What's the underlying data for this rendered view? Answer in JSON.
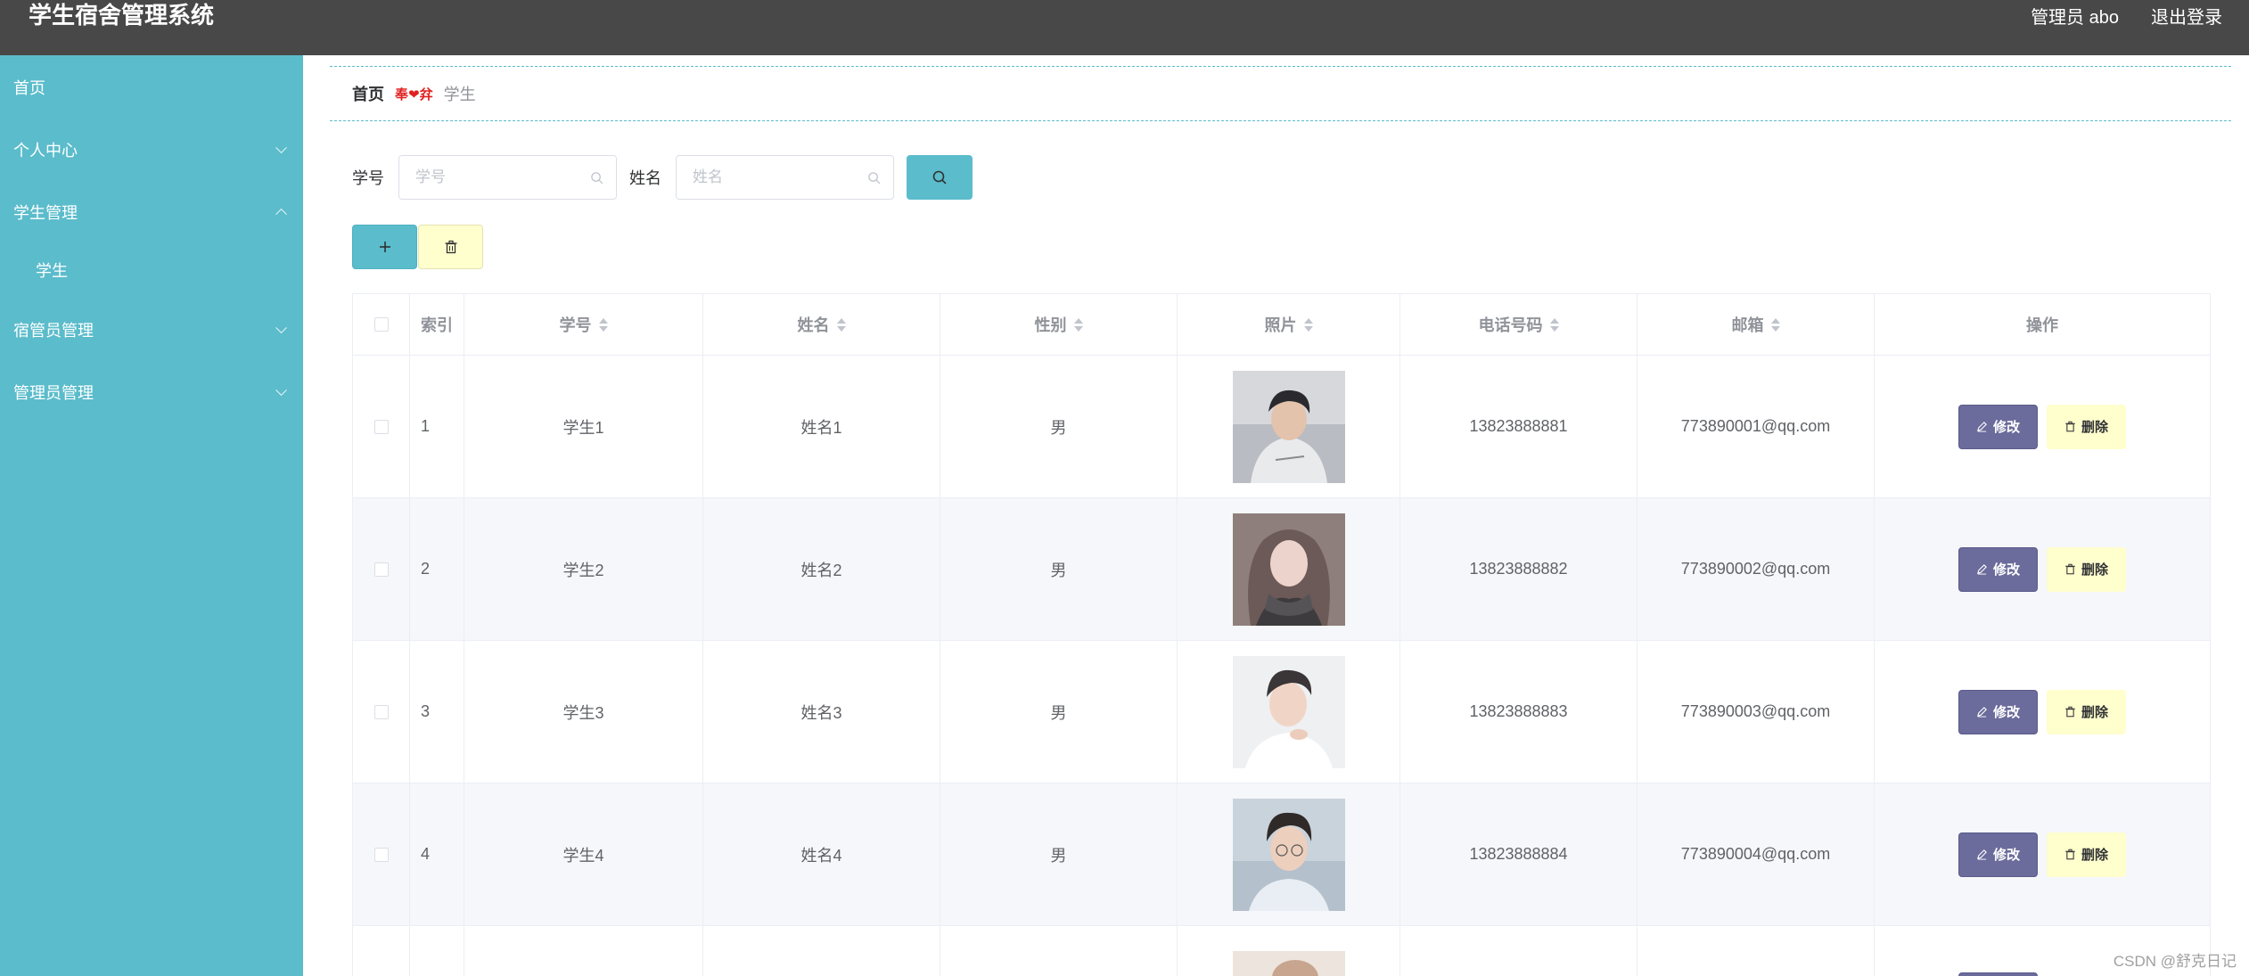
{
  "header": {
    "app_title": "学生宿舍管理系统",
    "user_label": "管理员 abo",
    "logout_label": "退出登录"
  },
  "sidebar": {
    "items": [
      {
        "label": "首页"
      },
      {
        "label": "个人中心",
        "expanded": false
      },
      {
        "label": "学生管理",
        "expanded": true
      },
      {
        "label": "学生",
        "submenu": true
      },
      {
        "label": "宿管员管理",
        "expanded": false
      },
      {
        "label": "管理员管理",
        "expanded": false
      }
    ]
  },
  "breadcrumb": {
    "home": "首页",
    "separator": "奉❤弅",
    "current": "学生"
  },
  "search": {
    "sno_label": "学号",
    "sno_placeholder": "学号",
    "sno_value": "",
    "name_label": "姓名",
    "name_placeholder": "姓名",
    "name_value": ""
  },
  "toolbar": {
    "add_icon": "plus-icon",
    "batch_delete_icon": "trash-icon"
  },
  "table": {
    "columns": [
      "索引",
      "学号",
      "姓名",
      "性别",
      "照片",
      "电话号码",
      "邮箱",
      "操作"
    ],
    "rows": [
      {
        "index": "1",
        "sno": "学生1",
        "name": "姓名1",
        "gender": "男",
        "phone": "13823888881",
        "email": "773890001@qq.com"
      },
      {
        "index": "2",
        "sno": "学生2",
        "name": "姓名2",
        "gender": "男",
        "phone": "13823888882",
        "email": "773890002@qq.com"
      },
      {
        "index": "3",
        "sno": "学生3",
        "name": "姓名3",
        "gender": "男",
        "phone": "13823888883",
        "email": "773890003@qq.com"
      },
      {
        "index": "4",
        "sno": "学生4",
        "name": "姓名4",
        "gender": "男",
        "phone": "13823888884",
        "email": "773890004@qq.com"
      }
    ],
    "edit_label": "修改",
    "delete_label": "删除"
  },
  "colors": {
    "header_bg": "#484848",
    "sidebar_bg": "#5bbccb",
    "edit_btn": "#6b6b9c",
    "delete_btn": "#fffecd"
  },
  "watermark": "CSDN @舒克日记"
}
